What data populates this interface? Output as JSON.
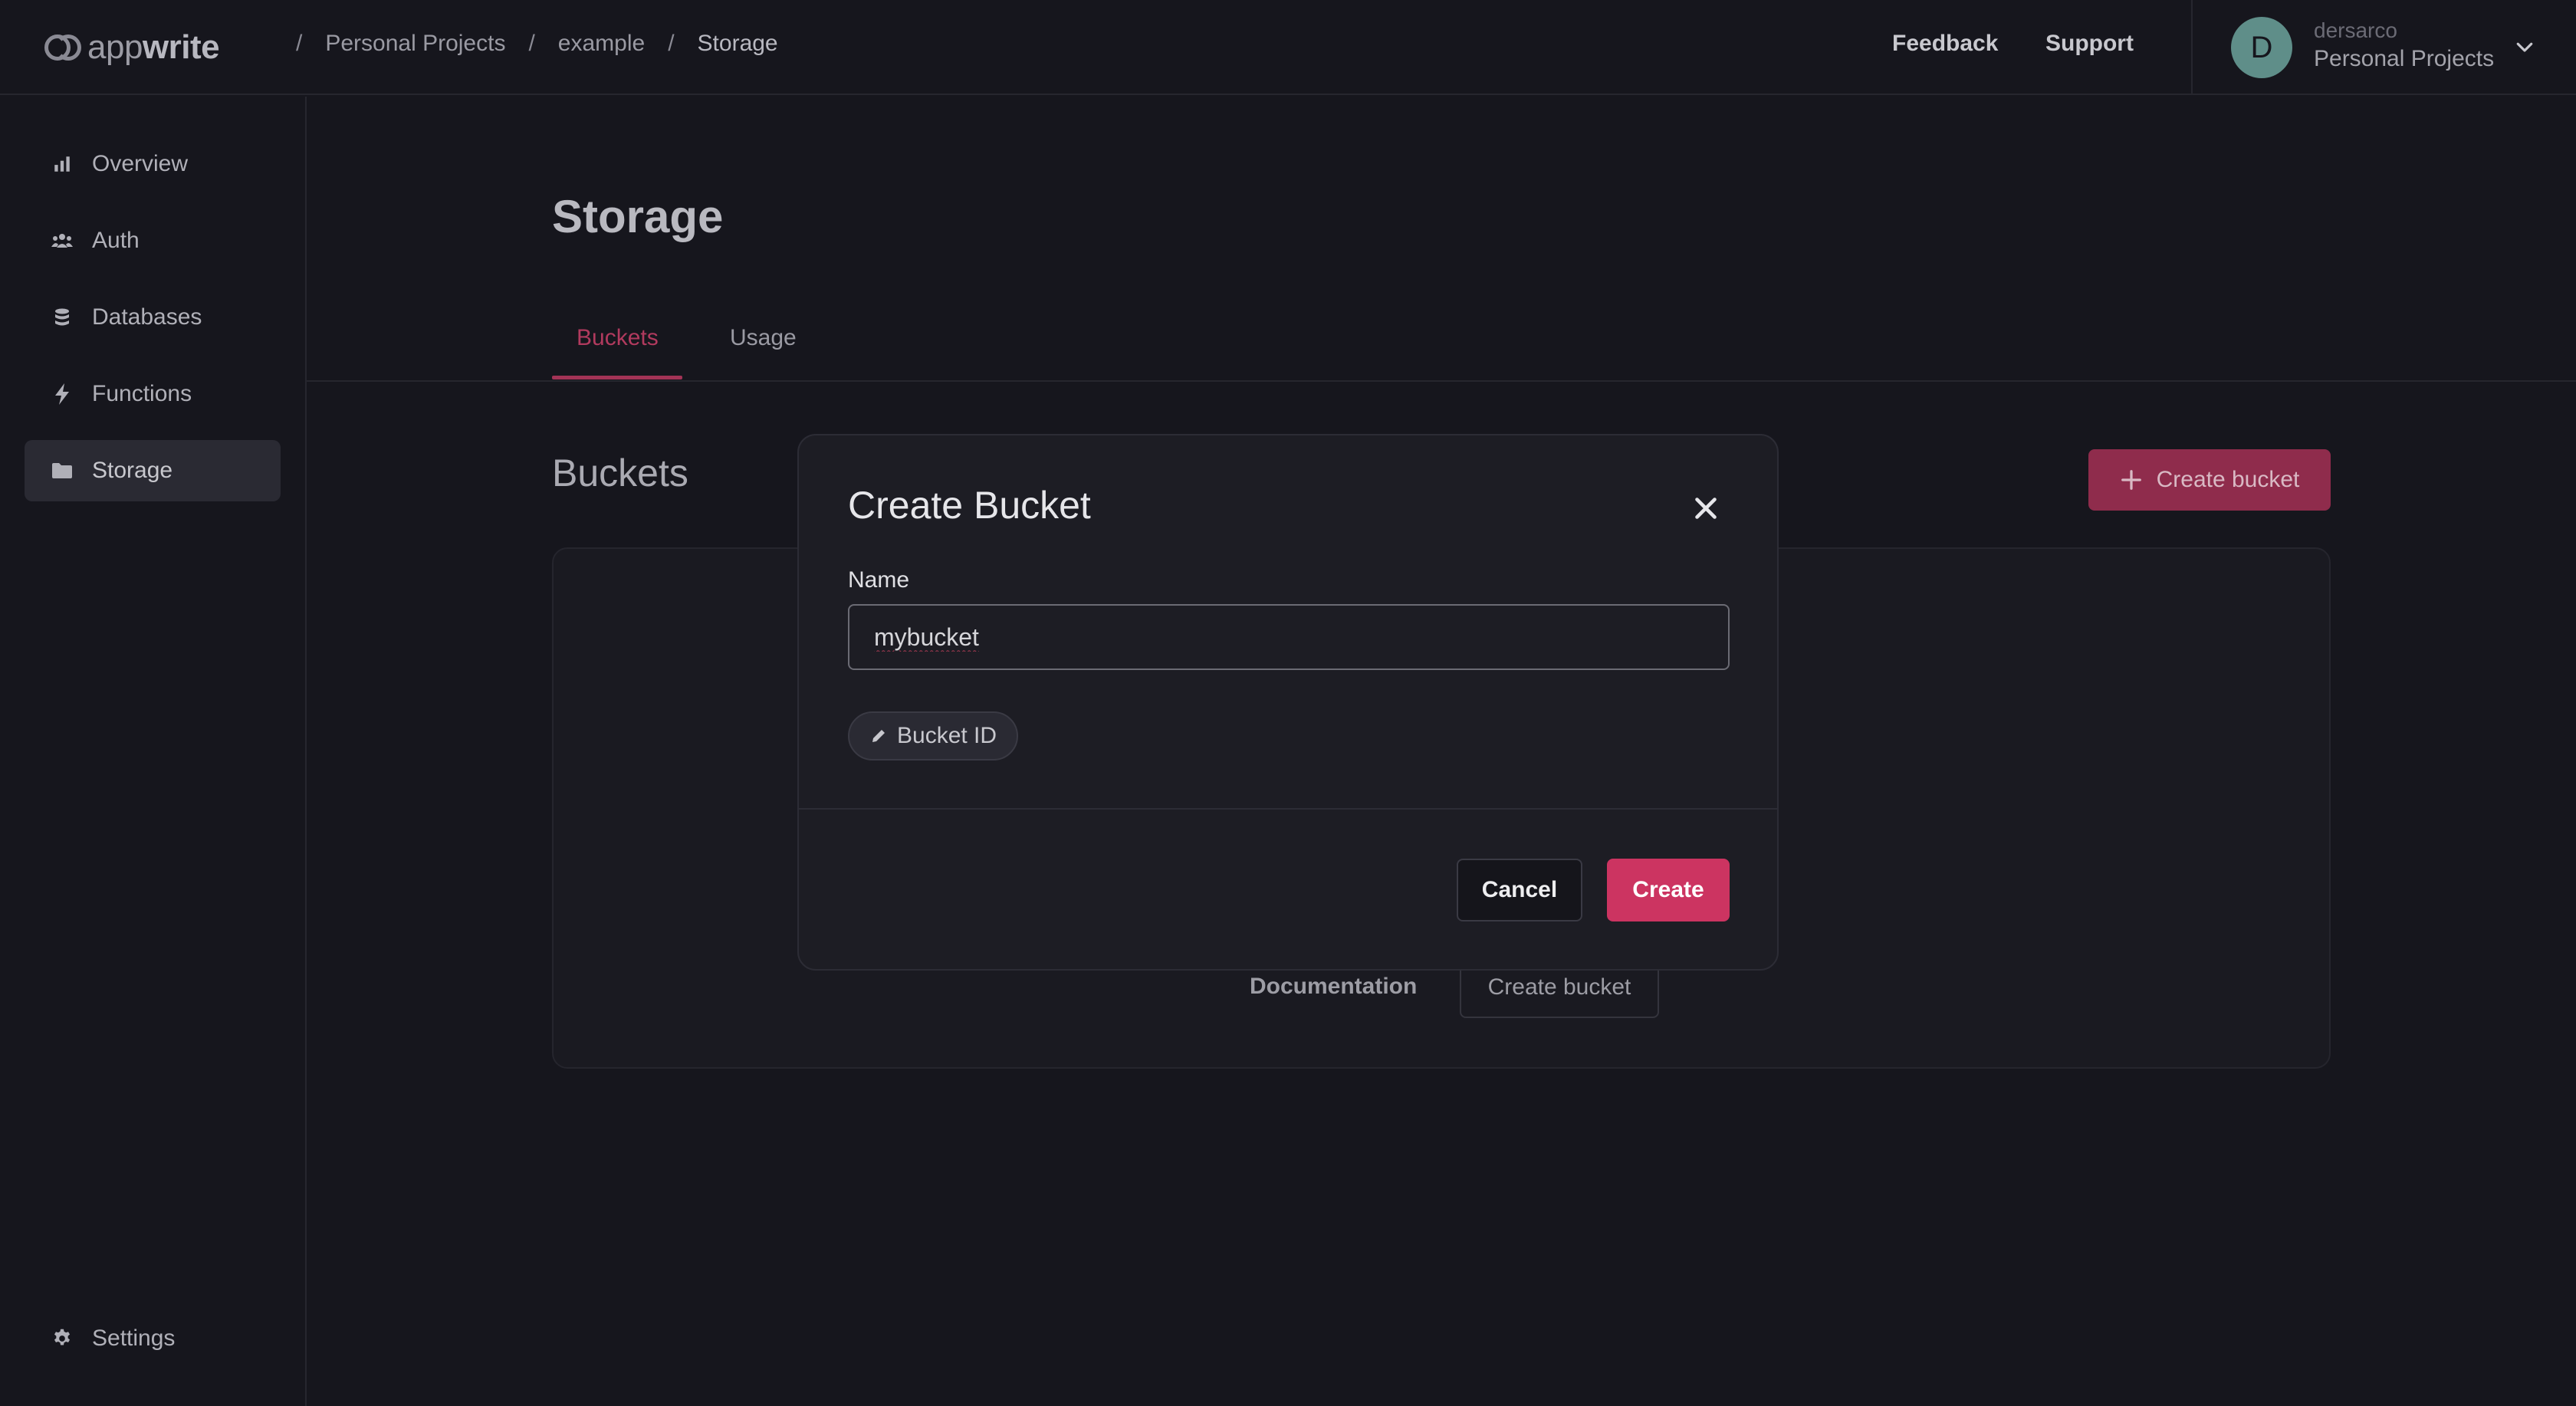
{
  "header": {
    "logo": {
      "text_light": "app",
      "text_bold": "write"
    },
    "breadcrumbs": [
      "Personal Projects",
      "example",
      "Storage"
    ],
    "separator": "/",
    "links": {
      "feedback": "Feedback",
      "support": "Support"
    },
    "user": {
      "initial": "D",
      "name": "dersarco",
      "org": "Personal Projects"
    }
  },
  "sidebar": {
    "items": [
      {
        "label": "Overview",
        "icon": "bar-chart-icon"
      },
      {
        "label": "Auth",
        "icon": "users-icon"
      },
      {
        "label": "Databases",
        "icon": "database-icon"
      },
      {
        "label": "Functions",
        "icon": "lightning-icon"
      },
      {
        "label": "Storage",
        "icon": "folder-icon",
        "active": true
      }
    ],
    "settings": {
      "label": "Settings",
      "icon": "gear-icon"
    }
  },
  "main": {
    "title": "Storage",
    "tabs": [
      {
        "label": "Buckets",
        "active": true
      },
      {
        "label": "Usage"
      }
    ],
    "section_title": "Buckets",
    "create_button": "Create bucket",
    "empty_state": {
      "documentation": "Documentation",
      "create_button": "Create bucket"
    }
  },
  "modal": {
    "title": "Create Bucket",
    "name_label": "Name",
    "name_value": "mybucket",
    "bucket_id_chip": "Bucket ID",
    "cancel": "Cancel",
    "create": "Create"
  },
  "colors": {
    "accent": "#cc3461",
    "accent_dim": "#8f2c4c",
    "background": "#16161d",
    "modal_bg": "#1d1d24"
  }
}
